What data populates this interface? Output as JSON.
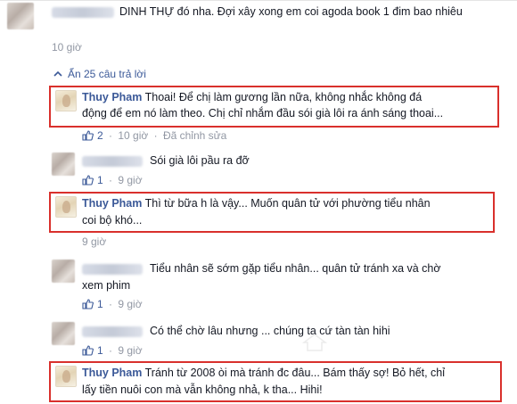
{
  "top_comment": {
    "text": "DINH THỰ đó nha. Đợi xây xong em coi agoda book 1 đim bao nhiêu",
    "time": "10 giờ"
  },
  "replies_toggle": {
    "icon": "chevron-up-icon",
    "label": "Ẩn 25 câu trả lời"
  },
  "replies": [
    {
      "author": "Thuy Pham",
      "line1": "Thoai! Để chị làm gương lần nữa, không nhắc không đá",
      "line2": "động để em nó làm theo. Chị chỉ nhắm đầu sói già lôi ra ánh sáng thoai...",
      "likes": "2",
      "time": "10 giờ",
      "edited": "Đã chỉnh sửa"
    },
    {
      "line1": "Sói già lôi pầu ra đỡ",
      "likes": "1",
      "time": "9 giờ"
    },
    {
      "author": "Thuy Pham",
      "line1": "Thì từ bữa h là vậy... Muốn quân tử với phường tiểu nhân",
      "line2": "coi bộ khó...",
      "time": "9 giờ"
    },
    {
      "line1": "Tiểu nhân sẽ sớm gặp tiểu nhân... quân tử tránh xa và chờ",
      "line2": "xem phim",
      "likes": "1",
      "time": "9 giờ"
    },
    {
      "line1": "Có thể chờ lâu nhưng ... chúng ta cứ tàn tàn hihi",
      "likes": "1",
      "time": "9 giờ"
    },
    {
      "author": "Thuy Pham",
      "line1": "Tránh từ 2008 òi mà tránh đc đâu... Bám thấy sợ! Bỏ hết, chỉ",
      "line2": "lấy tiền nuôi con mà vẫn không nhả, k tha... Hihi!"
    }
  ],
  "separator": "·",
  "colors": {
    "link": "#3b5998",
    "meta": "#9197a3",
    "highlight": "#d9302c"
  }
}
